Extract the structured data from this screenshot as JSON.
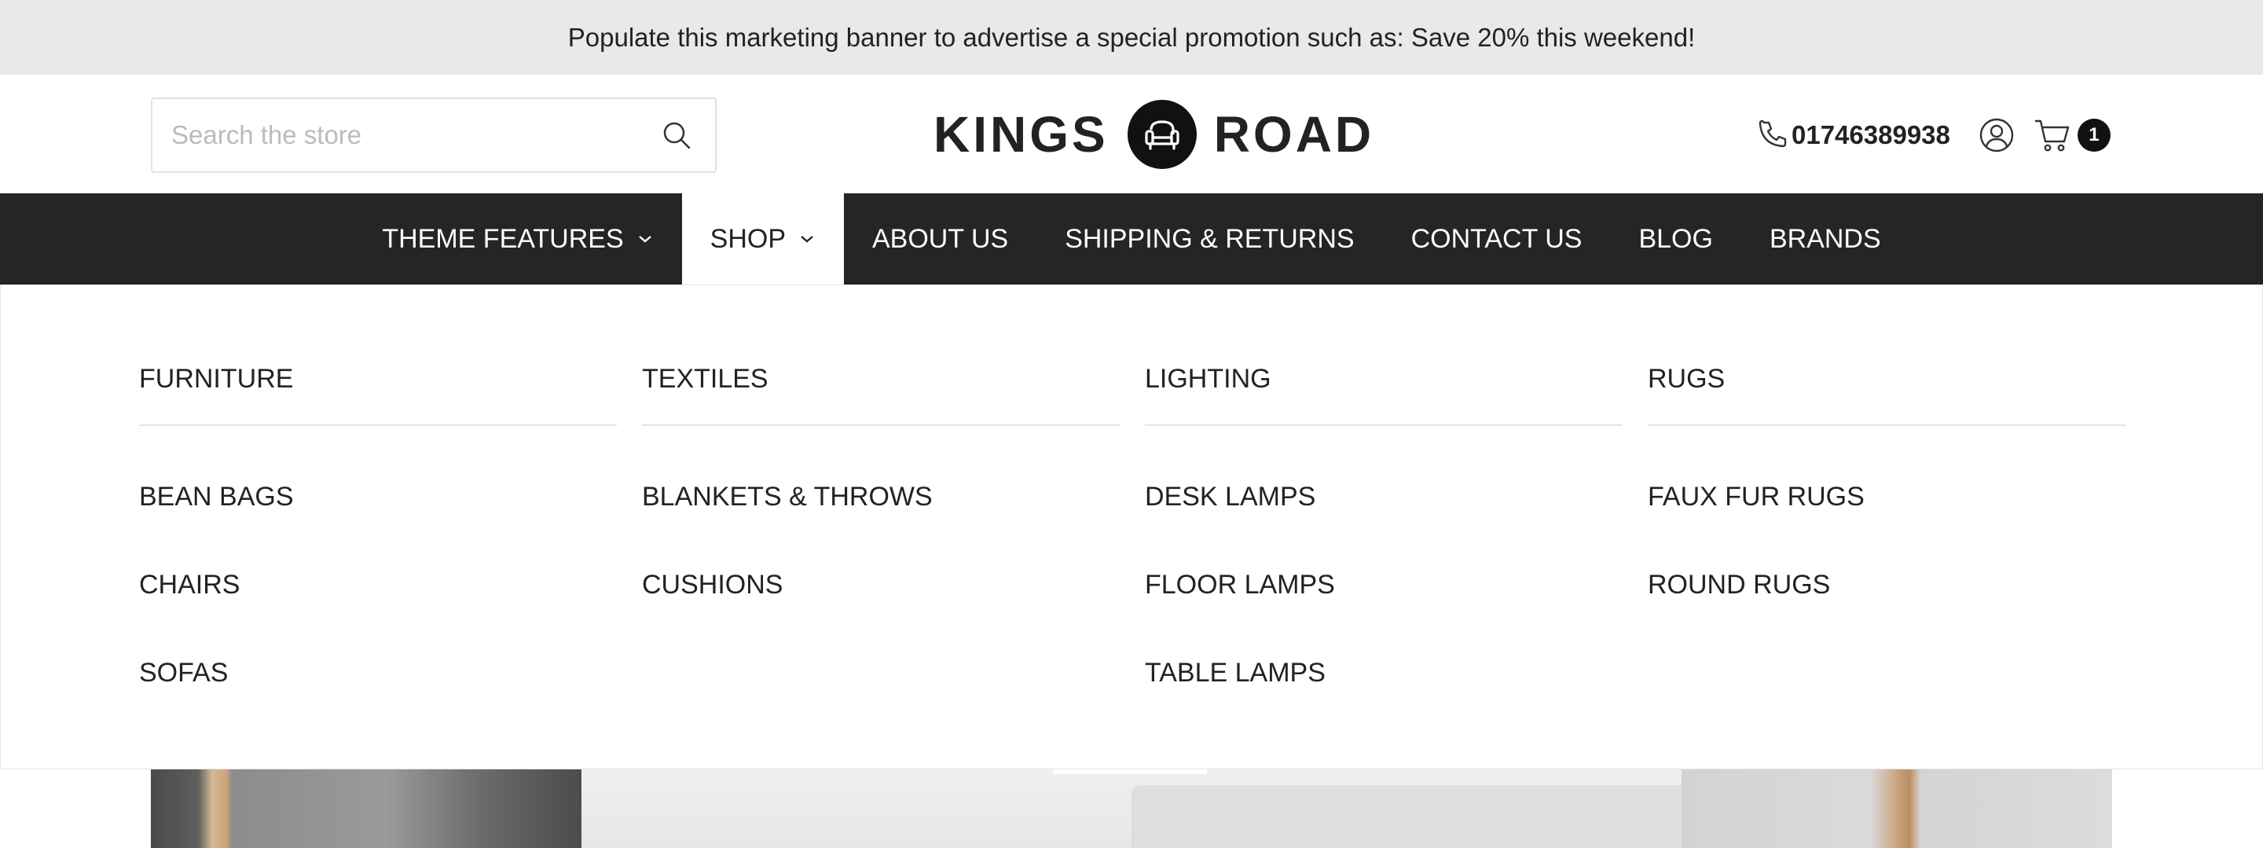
{
  "promo_banner": {
    "text": "Populate this marketing banner to advertise a special promotion such as: Save 20% this weekend!"
  },
  "header": {
    "search": {
      "placeholder": "Search the store",
      "icon": "search-icon"
    },
    "logo": {
      "left": "KINGS",
      "right": "ROAD",
      "icon": "armchair-icon"
    },
    "phone": {
      "icon": "phone-icon",
      "number": "01746389938"
    },
    "account": {
      "icon": "account-icon"
    },
    "cart": {
      "icon": "cart-icon",
      "count": "1"
    }
  },
  "nav": {
    "items": [
      {
        "label": "THEME FEATURES",
        "has_dropdown": true,
        "active": false
      },
      {
        "label": "SHOP",
        "has_dropdown": true,
        "active": true
      },
      {
        "label": "ABOUT US",
        "has_dropdown": false,
        "active": false
      },
      {
        "label": "SHIPPING & RETURNS",
        "has_dropdown": false,
        "active": false
      },
      {
        "label": "CONTACT US",
        "has_dropdown": false,
        "active": false
      },
      {
        "label": "BLOG",
        "has_dropdown": false,
        "active": false
      },
      {
        "label": "BRANDS",
        "has_dropdown": false,
        "active": false
      }
    ]
  },
  "megamenu": {
    "columns": [
      {
        "heading": "FURNITURE",
        "links": [
          "BEAN BAGS",
          "CHAIRS",
          "SOFAS"
        ]
      },
      {
        "heading": "TEXTILES",
        "links": [
          "BLANKETS & THROWS",
          "CUSHIONS"
        ]
      },
      {
        "heading": "LIGHTING",
        "links": [
          "DESK LAMPS",
          "FLOOR LAMPS",
          "TABLE LAMPS"
        ]
      },
      {
        "heading": "RUGS",
        "links": [
          "FAUX FUR RUGS",
          "ROUND RUGS"
        ]
      }
    ]
  },
  "colors": {
    "banner_bg": "#e9e9e9",
    "nav_bg": "#252525",
    "nav_text": "#ffffff",
    "text": "#222222",
    "cart_badge": "#111111"
  }
}
